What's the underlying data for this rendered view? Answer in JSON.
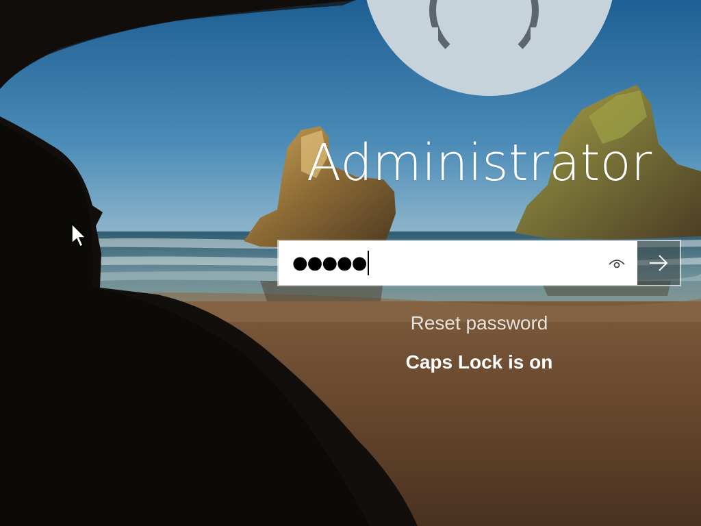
{
  "user": {
    "name": "Administrator",
    "avatar_icon": "user-avatar-icon"
  },
  "password": {
    "masked_value": "●●●●●",
    "reveal_icon": "eye-icon",
    "submit_icon": "arrow-right-icon"
  },
  "links": {
    "reset_password": "Reset password"
  },
  "status": {
    "caps_lock": "Caps Lock is on"
  },
  "colors": {
    "avatar_bg": "#c6d3db",
    "text": "#ffffff",
    "field_bg": "#ffffff"
  }
}
